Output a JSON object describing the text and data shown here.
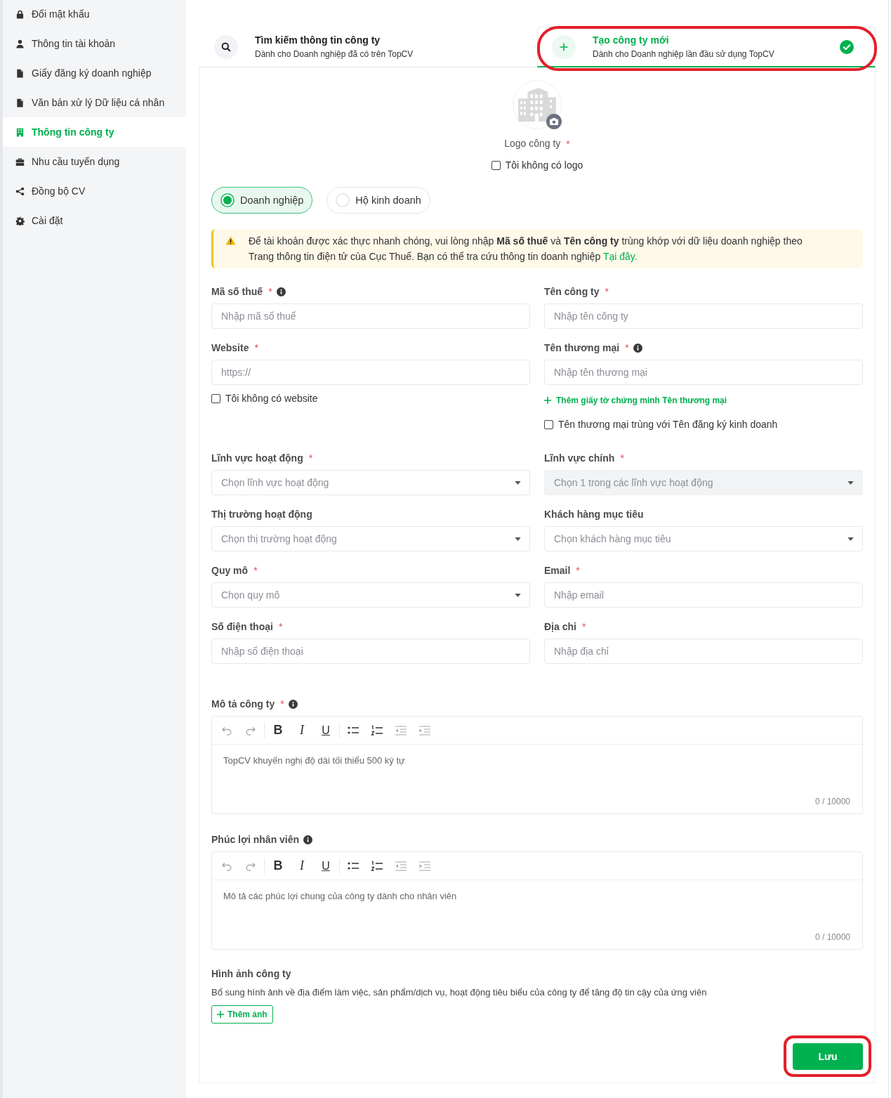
{
  "sidebar": {
    "items": [
      {
        "label": "Đổi mật khẩu",
        "selected": false
      },
      {
        "label": "Thông tin tài khoản",
        "selected": false
      },
      {
        "label": "Giấy đăng ký doanh nghiệp",
        "selected": false
      },
      {
        "label": "Văn bản xử lý Dữ liệu cá nhân",
        "selected": false
      },
      {
        "label": "Thông tin công ty",
        "selected": true
      },
      {
        "label": "Nhu cầu tuyển dụng",
        "selected": false
      },
      {
        "label": "Đồng bộ CV",
        "selected": false
      },
      {
        "label": "Cài đặt",
        "selected": false
      }
    ]
  },
  "tabs": [
    {
      "title": "Tìm kiếm thông tin công ty",
      "subtitle": "Dành cho Doanh nghiệp đã có trên TopCV",
      "selected": false,
      "highlighted": false
    },
    {
      "title": "Tạo công ty mới",
      "subtitle": "Dành cho Doanh nghiệp lần đầu sử dụng TopCV",
      "selected": true,
      "highlighted": true
    }
  ],
  "logo": {
    "label": "Logo công ty",
    "mark": "*",
    "no_logo": {
      "label": "Tôi không có logo",
      "checked": false
    }
  },
  "business_types": [
    {
      "label": "Doanh nghiệp",
      "selected": true
    },
    {
      "label": "Hộ kinh doanh",
      "selected": false
    }
  ],
  "alert": {
    "text": "Để tài khoản được xác thực nhanh chóng, vui lòng nhập **Mã số thuế** và **Tên công ty** trùng khớp với dữ liệu doanh nghiệp theo Trang thông tin điện tử của Cục Thuế. Bạn có thể tra cứu thông tin doanh nghiệp",
    "link": "Tại đây."
  },
  "fields": [
    {
      "label": "Mã số thuế",
      "mark": "*",
      "info": true,
      "kind": "input",
      "placeholder": "Nhập mã số thuế",
      "disabled": false
    },
    {
      "label": "Tên công ty",
      "mark": "*",
      "info": false,
      "kind": "input",
      "placeholder": "Nhập tên công ty",
      "disabled": false
    },
    {
      "label": "Website",
      "mark": "*",
      "info": false,
      "kind": "input",
      "placeholder": "https://",
      "disabled": false,
      "extras": [
        {
          "kind": "checkbox",
          "label": "Tôi không có website",
          "checked": false
        }
      ]
    },
    {
      "label": "Tên thương mại",
      "mark": "*",
      "info": true,
      "kind": "input",
      "placeholder": "Nhập tên thương mại",
      "disabled": false,
      "extras": [
        {
          "kind": "link",
          "label": "Thêm giấy tờ chứng minh Tên thương mại"
        },
        {
          "kind": "checkbox",
          "label": "Tên thương mại trùng với Tên đăng ký kinh doanh",
          "checked": false
        }
      ]
    },
    {
      "label": "Lĩnh vực hoạt động",
      "mark": "*",
      "info": false,
      "kind": "select",
      "placeholder": "Chọn lĩnh vực hoạt động",
      "disabled": false
    },
    {
      "label": "Lĩnh vực chính",
      "mark": "*",
      "info": false,
      "kind": "select",
      "placeholder": "Chọn 1 trong các lĩnh vực hoạt động",
      "disabled": true
    },
    {
      "label": "Thị trường hoạt động",
      "info": false,
      "kind": "select",
      "placeholder": "Chọn thị trường hoạt động",
      "disabled": false
    },
    {
      "label": "Khách hàng mục tiêu",
      "info": false,
      "kind": "select",
      "placeholder": "Chọn khách hàng mục tiêu",
      "disabled": false
    },
    {
      "label": "Quy mô",
      "mark": "*",
      "info": false,
      "kind": "select",
      "placeholder": "Chọn quy mô",
      "disabled": false
    },
    {
      "label": "Email",
      "mark": "*",
      "info": false,
      "kind": "input",
      "placeholder": "Nhập email",
      "disabled": false
    },
    {
      "label": "Số điện thoại",
      "mark": "*",
      "info": false,
      "kind": "input",
      "placeholder": "Nhập số điện thoại",
      "disabled": false
    },
    {
      "label": "Địa chỉ",
      "mark": "*",
      "info": false,
      "kind": "input",
      "placeholder": "Nhập địa chỉ",
      "disabled": false
    }
  ],
  "editors": [
    {
      "label": "Mô tả công ty",
      "mark": "*",
      "info": true,
      "toolbar": [
        {
          "kind": "undo",
          "disabled": true
        },
        {
          "kind": "redo",
          "disabled": true
        },
        {
          "kind": "bold",
          "label": "B",
          "disabled": false
        },
        {
          "kind": "italic",
          "label": "I",
          "disabled": false
        },
        {
          "kind": "underline",
          "label": "U",
          "disabled": false
        },
        {
          "kind": "bullet_list",
          "disabled": false
        },
        {
          "kind": "numbered_list",
          "disabled": false
        },
        {
          "kind": "outdent",
          "disabled": true
        },
        {
          "kind": "indent",
          "disabled": true
        }
      ],
      "placeholder": "TopCV khuyến nghị độ dài tối thiểu 500 ký tự",
      "counter": "0 / 10000"
    },
    {
      "label": "Phúc lợi nhân viên",
      "info": true,
      "toolbar": [
        {
          "kind": "undo",
          "disabled": true
        },
        {
          "kind": "redo",
          "disabled": true
        },
        {
          "kind": "bold",
          "label": "B",
          "disabled": false
        },
        {
          "kind": "italic",
          "label": "I",
          "disabled": false
        },
        {
          "kind": "underline",
          "label": "U",
          "disabled": false
        },
        {
          "kind": "bullet_list",
          "disabled": false
        },
        {
          "kind": "numbered_list",
          "disabled": false
        },
        {
          "kind": "outdent",
          "disabled": true
        },
        {
          "kind": "indent",
          "disabled": true
        }
      ],
      "placeholder": "Mô tả các phúc lợi chung của công ty dành cho nhân viên",
      "counter": "0 / 10000"
    }
  ],
  "gallery": {
    "title": "Hình ảnh công ty",
    "description": "Bổ sung hình ảnh về địa điểm làm việc, sản phẩm/dịch vụ, hoạt động tiêu biểu của công ty để tăng độ tin cậy của ứng viên",
    "add_button": "Thêm ảnh"
  },
  "save": {
    "label": "Lưu",
    "highlighted": true
  }
}
